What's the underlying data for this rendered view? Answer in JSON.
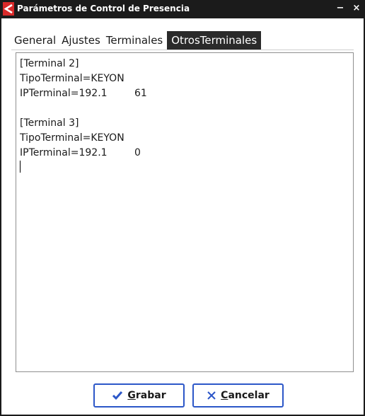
{
  "window": {
    "title": "Parámetros de Control de Presencia",
    "minimize_glyph": "−",
    "close_glyph": "×"
  },
  "tabs": [
    {
      "label": "General",
      "active": false
    },
    {
      "label": "Ajustes",
      "active": false
    },
    {
      "label": "Terminales",
      "active": false
    },
    {
      "label": "OtrosTerminales",
      "active": true
    }
  ],
  "editor": {
    "lines": [
      "[Terminal 2]",
      "TipoTerminal=KEYON",
      "IPTerminal=192.1",
      "",
      "[Terminal 3]",
      "TipoTerminal=KEYON",
      "IPTerminal=192.1"
    ],
    "redacted_tail_1": "61",
    "redacted_tail_2": "0"
  },
  "buttons": {
    "save": {
      "accel": "G",
      "rest": "rabar",
      "icon": "checkmark-icon"
    },
    "cancel": {
      "accel": "C",
      "rest": "ancelar",
      "icon": "x-icon"
    }
  },
  "colors": {
    "titlebar": "#1b1b1b",
    "app_icon": "#d92a2a",
    "button_border": "#2c57c8",
    "check_icon": "#2c57c8"
  }
}
